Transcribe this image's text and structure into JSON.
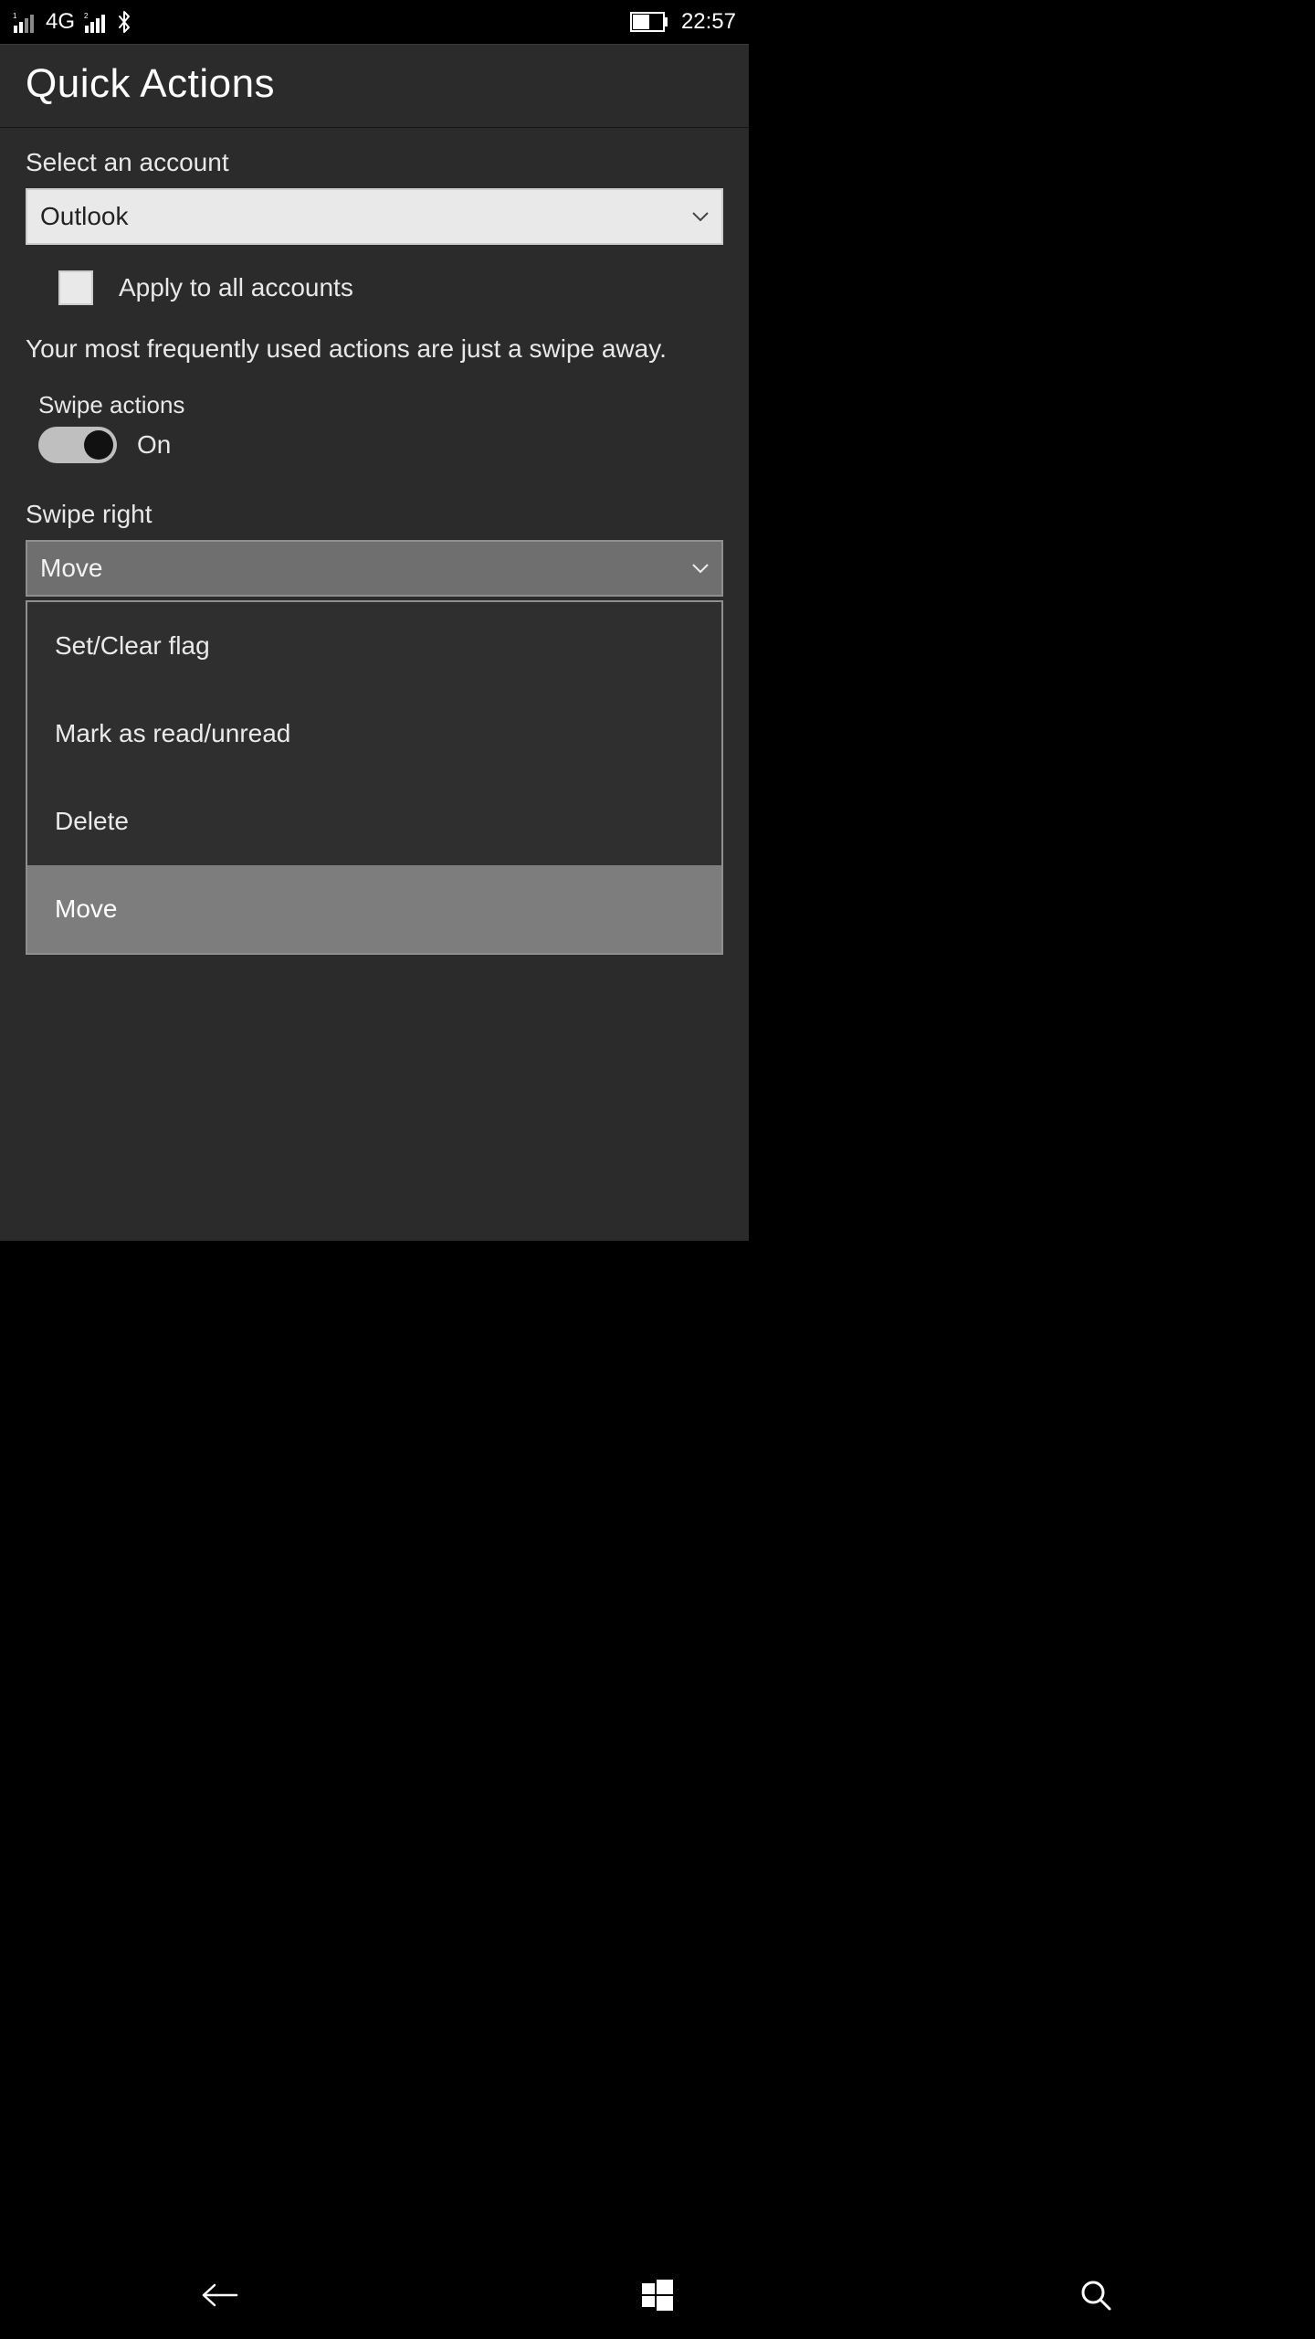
{
  "status": {
    "sim1_badge": "1",
    "network_type": "4G",
    "sim2_badge": "2",
    "time": "22:57"
  },
  "header": {
    "title": "Quick Actions"
  },
  "account": {
    "label": "Select an account",
    "selected": "Outlook",
    "apply_all_label": "Apply to all accounts",
    "apply_all_checked": false
  },
  "description": "Your most frequently used actions are just a swipe away.",
  "swipe_toggle": {
    "label": "Swipe actions",
    "state": "On",
    "on": true
  },
  "swipe_right": {
    "label": "Swipe right",
    "selected": "Move",
    "options": [
      "Set/Clear flag",
      "Mark as read/unread",
      "Delete",
      "Move"
    ]
  }
}
